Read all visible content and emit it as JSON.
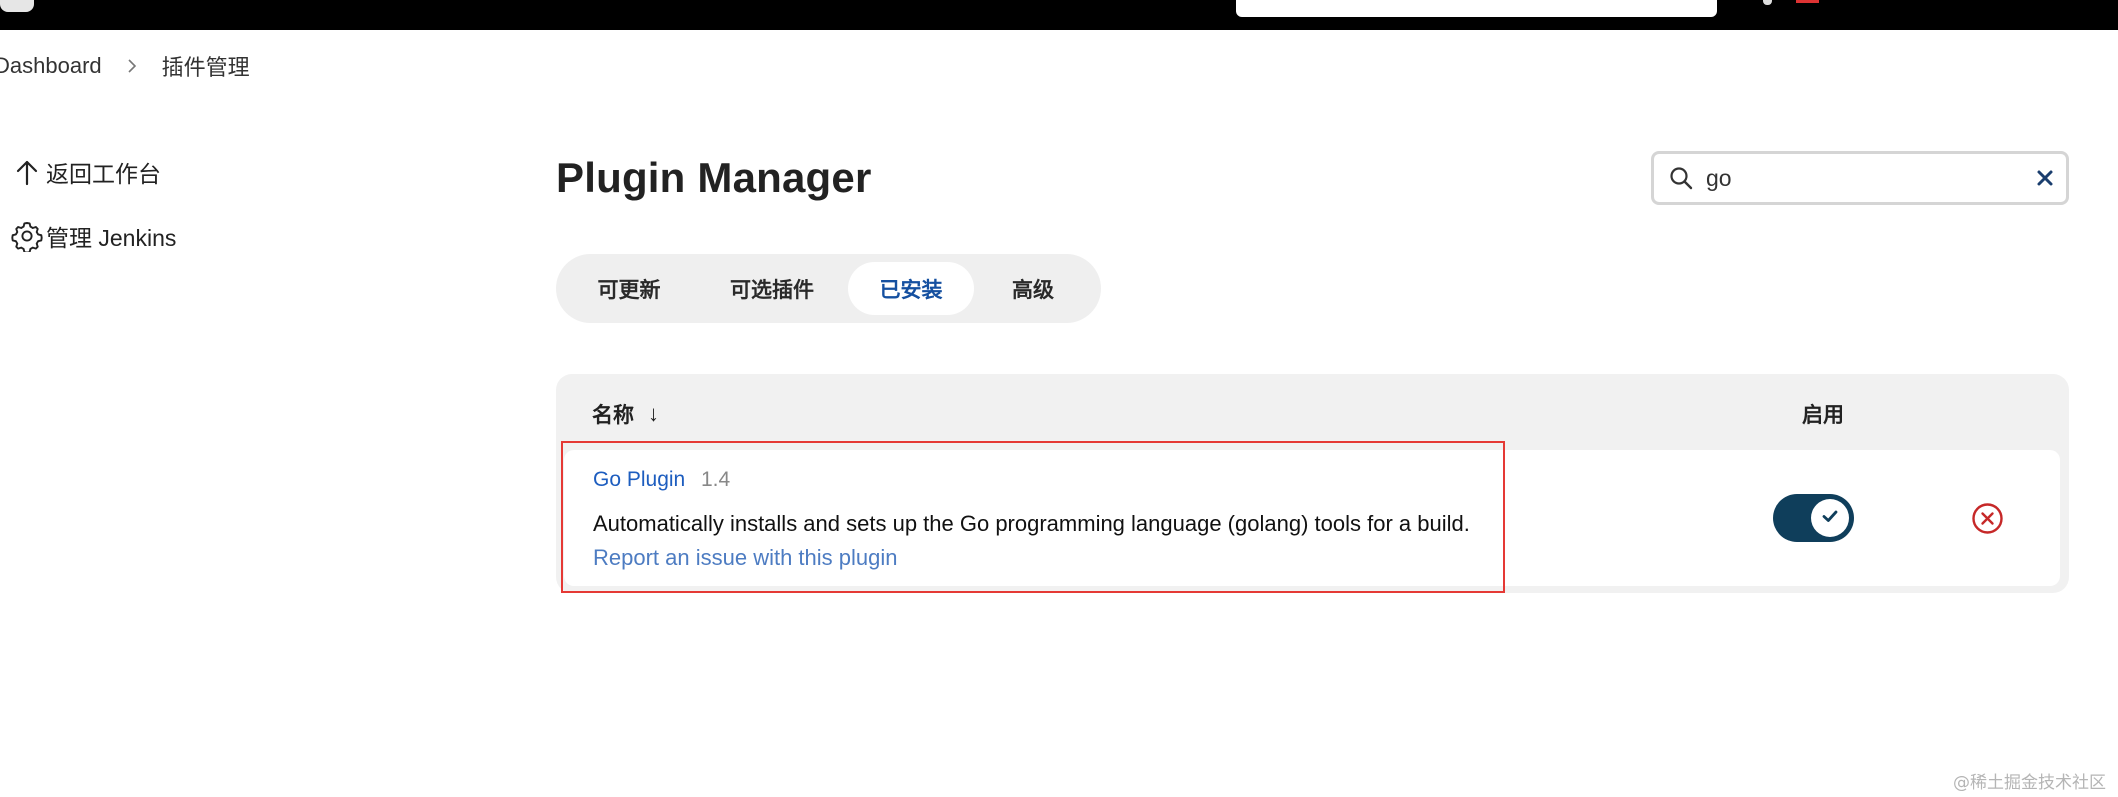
{
  "breadcrumb": {
    "items": [
      "Dashboard",
      "插件管理"
    ]
  },
  "sidebar": {
    "items": [
      {
        "label": "返回工作台",
        "icon": "arrow-up-icon"
      },
      {
        "label": "管理 Jenkins",
        "icon": "gear-icon"
      }
    ]
  },
  "page": {
    "title": "Plugin Manager"
  },
  "search": {
    "value": "go"
  },
  "tabs": [
    {
      "label": "可更新",
      "active": false
    },
    {
      "label": "可选插件",
      "active": false
    },
    {
      "label": "已安装",
      "active": true
    },
    {
      "label": "高级",
      "active": false
    }
  ],
  "table": {
    "headers": {
      "name": "名称",
      "sort_indicator": "↓",
      "enabled": "启用"
    },
    "rows": [
      {
        "name": "Go Plugin",
        "version": "1.4",
        "description": "Automatically installs and sets up the Go programming language (golang) tools for a build.",
        "report_link": "Report an issue with this plugin",
        "enabled": true
      }
    ]
  },
  "watermark": "@稀土掘金技术社区",
  "colors": {
    "accent": "#1550a0",
    "toggle_on": "#0f3e5b",
    "danger": "#d32f2f",
    "highlight_border": "#e53935"
  }
}
